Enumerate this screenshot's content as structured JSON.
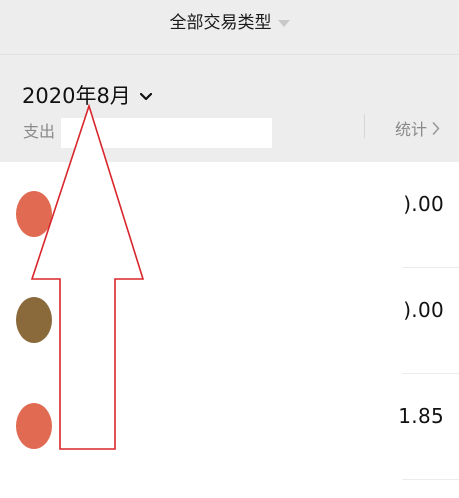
{
  "header": {
    "filter_label": "全部交易类型",
    "month_label": "2020年8月",
    "expense_label": "支出",
    "stats_label": "统计"
  },
  "transactions": [
    {
      "amount": ").00",
      "avatar_color": "#e06a52"
    },
    {
      "amount": ").00",
      "avatar_color": "#8a6a3a"
    },
    {
      "amount": "1.85",
      "avatar_color": "#e06a52"
    }
  ],
  "colors": {
    "header_bg": "#ededed",
    "annotation_arrow": "#d9262c"
  }
}
